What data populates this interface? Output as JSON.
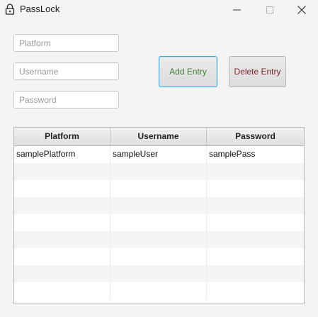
{
  "window": {
    "title": "PassLock",
    "icons": {
      "app": "lock-icon",
      "minimize": "minimize-icon",
      "maximize": "maximize-icon",
      "close": "close-icon"
    }
  },
  "form": {
    "platform_placeholder": "Platform",
    "username_placeholder": "Username",
    "password_placeholder": "Password",
    "platform_value": "",
    "username_value": "",
    "password_value": ""
  },
  "buttons": {
    "add_label": "Add Entry",
    "delete_label": "Delete Entry"
  },
  "colors": {
    "add_text": "#3f7a34",
    "delete_text": "#7a2626",
    "focus_border": "#3aa0e0"
  },
  "table": {
    "columns": [
      "Platform",
      "Username",
      "Password"
    ],
    "rows": [
      [
        "samplePlatform",
        "sampleUser",
        "samplePass"
      ]
    ]
  }
}
